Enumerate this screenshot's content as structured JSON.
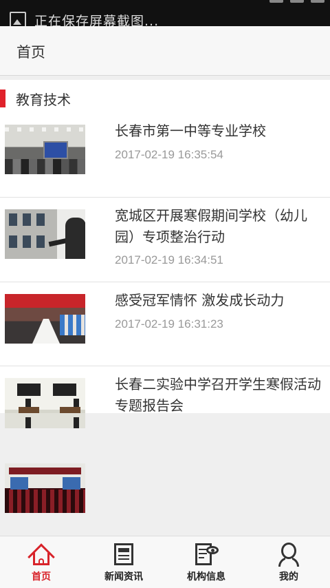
{
  "status_bar": {
    "notification_text": "正在保存屏幕截图..."
  },
  "header": {
    "title": "首页"
  },
  "section": {
    "title": "教育技术",
    "accent_color": "#e0222b"
  },
  "news": [
    {
      "title": "长春市第一中等专业学校",
      "date": "2017-02-19 16:35:54"
    },
    {
      "title": "宽城区开展寒假期间学校（幼儿园）专项整治行动",
      "date": "2017-02-19 16:34:51"
    },
    {
      "title": "感受冠军情怀 激发成长动力",
      "date": "2017-02-19 16:31:23"
    },
    {
      "title": "长春二实验中学召开学生寒假活动专题报告会",
      "date": ""
    }
  ],
  "bottom_nav": {
    "active_color": "#d8232a",
    "items": [
      {
        "label": "首页",
        "icon": "home-icon"
      },
      {
        "label": "新闻资讯",
        "icon": "newspaper-icon"
      },
      {
        "label": "机构信息",
        "icon": "document-eye-icon"
      },
      {
        "label": "我的",
        "icon": "user-icon"
      }
    ]
  }
}
